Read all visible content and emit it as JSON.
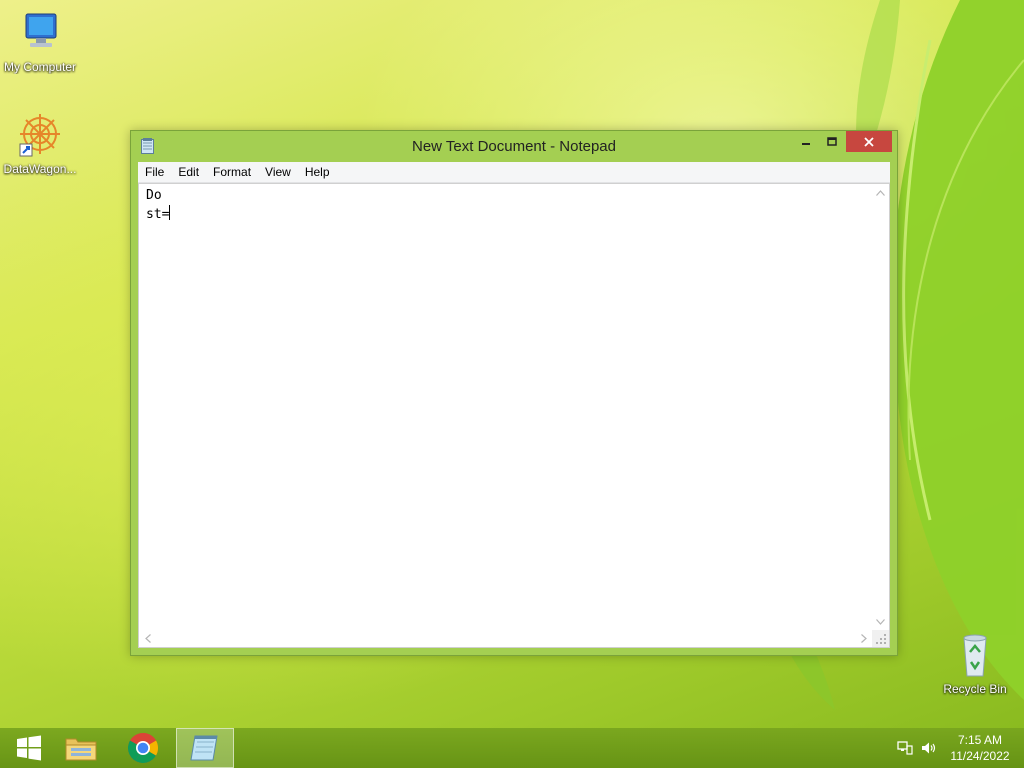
{
  "desktop": {
    "icons": [
      {
        "label": "My Computer",
        "icon": "computer-icon"
      },
      {
        "label": "DataWagon...",
        "icon": "datawagon-icon"
      },
      {
        "label": "Recycle Bin",
        "icon": "recycle-bin-icon"
      }
    ]
  },
  "window": {
    "title": "New Text Document - Notepad",
    "controls": {
      "minimize": "‒",
      "maximize": "☐",
      "close": "✕"
    },
    "menu": [
      "File",
      "Edit",
      "Format",
      "View",
      "Help"
    ],
    "content": {
      "line1": "Do",
      "line2": "st="
    }
  },
  "taskbar": {
    "items": [
      {
        "name": "start",
        "icon": "windows-logo-icon"
      },
      {
        "name": "file-explorer",
        "icon": "folder-icon"
      },
      {
        "name": "chrome",
        "icon": "chrome-icon"
      },
      {
        "name": "notepad",
        "icon": "notepad-icon",
        "active": true
      }
    ],
    "tray": {
      "network_icon": "network-icon",
      "volume_icon": "volume-icon"
    },
    "clock": {
      "time": "7:15 AM",
      "date": "11/24/2022"
    }
  },
  "colors": {
    "window_frame": "#a4cf52",
    "close_button": "#c7473f",
    "taskbar": "#7aa51e"
  }
}
